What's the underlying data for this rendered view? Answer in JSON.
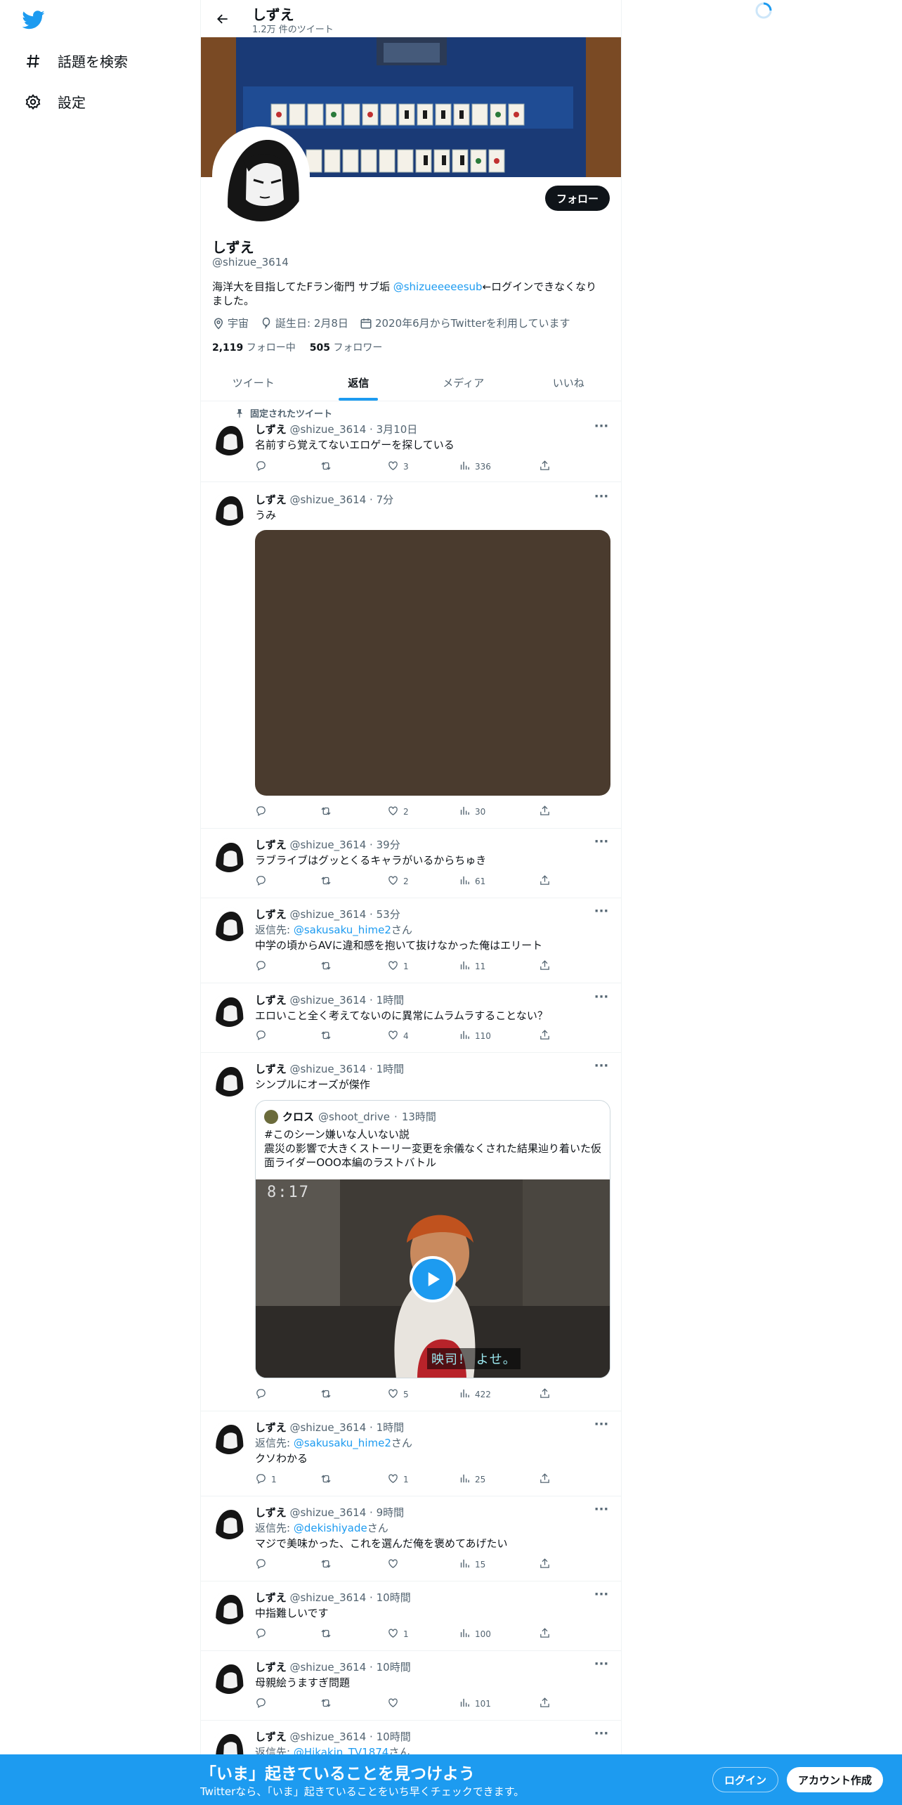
{
  "sidebar": {
    "items": [
      {
        "label": "話題を検索",
        "icon": "hashtag-icon"
      },
      {
        "label": "設定",
        "icon": "gear-icon"
      }
    ]
  },
  "header": {
    "title": "しずえ",
    "subtitle": "1.2万 件のツイート"
  },
  "profile": {
    "name": "しずえ",
    "handle": "@shizue_3614",
    "follow_label": "フォロー",
    "bio_before": "海洋大を目指してたFラン衛門 サブ垢 ",
    "bio_mention": "@shizueeeeesub",
    "bio_after": "←ログインできなくなりました。",
    "location": "宇宙",
    "birthday": "誕生日: 2月8日",
    "joined": "2020年6月からTwitterを利用しています",
    "following_count": "2,119",
    "following_label": "フォロー中",
    "followers_count": "505",
    "followers_label": "フォロワー"
  },
  "tabs": [
    {
      "label": "ツイート"
    },
    {
      "label": "返信",
      "active": true
    },
    {
      "label": "メディア"
    },
    {
      "label": "いいね"
    }
  ],
  "pinned_label": "固定されたツイート",
  "tweets": [
    {
      "name": "しずえ",
      "handle": "@shizue_3614",
      "time": "3月10日",
      "text": "名前すら覚えてないエロゲーを探している",
      "replies": "",
      "retweets": "",
      "likes": "3",
      "views": "336"
    },
    {
      "name": "しずえ",
      "handle": "@shizue_3614",
      "time": "7分",
      "text": "うみ",
      "replies": "",
      "retweets": "",
      "likes": "2",
      "views": "30"
    },
    {
      "name": "しずえ",
      "handle": "@shizue_3614",
      "time": "39分",
      "text": "ラブライブはグッとくるキャラがいるからちゅき",
      "replies": "",
      "retweets": "",
      "likes": "2",
      "views": "61"
    },
    {
      "name": "しずえ",
      "handle": "@shizue_3614",
      "time": "53分",
      "reply_prefix": "返信先: ",
      "reply_to": "@sakusaku_hime2",
      "reply_suffix": "さん",
      "text": "中学の頃からAVに違和感を抱いて抜けなかった俺はエリート",
      "replies": "",
      "retweets": "",
      "likes": "1",
      "views": "11"
    },
    {
      "name": "しずえ",
      "handle": "@shizue_3614",
      "time": "1時間",
      "text": "エロいこと全く考えてないのに異常にムラムラすることない？",
      "replies": "",
      "retweets": "",
      "likes": "4",
      "views": "110"
    },
    {
      "name": "しずえ",
      "handle": "@shizue_3614",
      "time": "1時間",
      "text": "シンプルにオーズが傑作",
      "replies": "",
      "retweets": "",
      "likes": "5",
      "views": "422",
      "quote": {
        "name": "クロス",
        "handle": "@shoot_drive",
        "time": "13時間",
        "line1": "#このシーン嫌いな人いない説",
        "line2": "震災の影響で大きくストーリー変更を余儀なくされた結果辿り着いた仮",
        "line3": "面ライダーOOO本編のラストバトル",
        "video_time": "8:17",
        "subtitle": "映司！ よせ。"
      }
    },
    {
      "name": "しずえ",
      "handle": "@shizue_3614",
      "time": "1時間",
      "reply_prefix": "返信先: ",
      "reply_to": "@sakusaku_hime2",
      "reply_suffix": "さん",
      "text": "クソわかる",
      "replies": "1",
      "retweets": "",
      "likes": "1",
      "views": "25"
    },
    {
      "name": "しずえ",
      "handle": "@shizue_3614",
      "time": "9時間",
      "reply_prefix": "返信先: ",
      "reply_to": "@dekishiyade",
      "reply_suffix": "さん",
      "text": "マジで美味かった、これを選んだ俺を褒めてあげたい",
      "replies": "",
      "retweets": "",
      "likes": "",
      "views": "15"
    },
    {
      "name": "しずえ",
      "handle": "@shizue_3614",
      "time": "10時間",
      "text": "中指難しいです",
      "replies": "",
      "retweets": "",
      "likes": "1",
      "views": "100"
    },
    {
      "name": "しずえ",
      "handle": "@shizue_3614",
      "time": "10時間",
      "text": "母親絵うますぎ問題",
      "replies": "",
      "retweets": "",
      "likes": "",
      "views": "101"
    },
    {
      "name": "しずえ",
      "handle": "@shizue_3614",
      "time": "10時間",
      "reply_prefix": "返信先: ",
      "reply_to": "@Hikakin_TV1874",
      "reply_suffix": "さん"
    }
  ],
  "bottom_banner": {
    "title": "「いま」起きていることを見つけよう",
    "subtitle": "Twitterなら、「いま」起きていることをいち早くチェックできます。",
    "login": "ログイン",
    "signup": "アカウント作成"
  },
  "colors": {
    "accent": "#1d9bf0",
    "text": "#0f1419",
    "muted": "#536471",
    "border": "#eff3f4"
  }
}
